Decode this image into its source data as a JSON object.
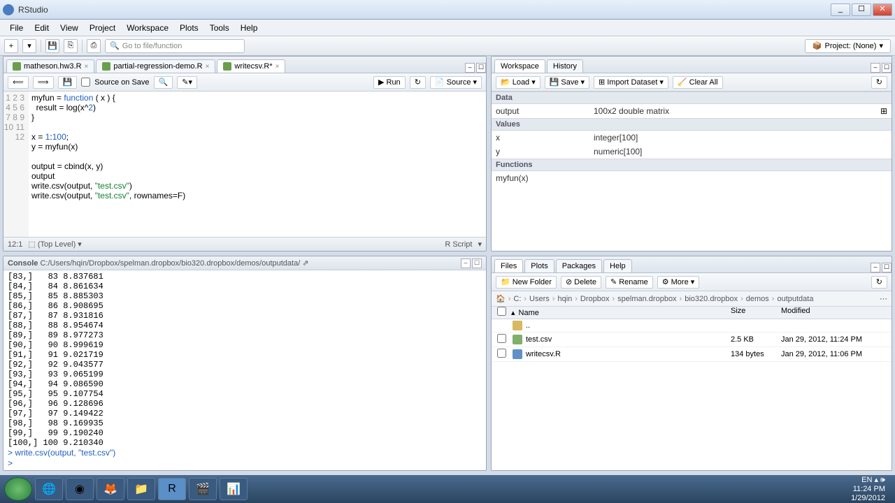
{
  "window": {
    "title": "RStudio"
  },
  "menu": {
    "file": "File",
    "edit": "Edit",
    "view": "View",
    "project": "Project",
    "workspace": "Workspace",
    "plots": "Plots",
    "tools": "Tools",
    "help": "Help"
  },
  "toolbar": {
    "goto": "Go to file/function",
    "project_btn": "Project: (None)"
  },
  "source": {
    "tabs": [
      {
        "label": "matheson.hw3.R"
      },
      {
        "label": "partial-regression-demo.R"
      },
      {
        "label": "writecsv.R*"
      }
    ],
    "source_on_save": "Source on Save",
    "run": "Run",
    "source_btn": "Source",
    "lines": [
      "myfun = function ( x ) {",
      "  result = log(x^2)",
      "}",
      "",
      "x = 1:100;",
      "y = myfun(x)",
      "",
      "output = cbind(x, y)",
      "output",
      "write.csv(output, \"test.csv\")",
      "write.csv(output, \"test.csv\", rownames=F)",
      ""
    ],
    "status_pos": "12:1",
    "status_scope": "(Top Level)",
    "status_lang": "R Script"
  },
  "console": {
    "title": "Console",
    "path": "C:/Users/hqin/Dropbox/spelman.dropbox/bio320.dropbox/demos/outputdata/",
    "rows": [
      "[83,]   83 8.837681",
      "[84,]   84 8.861634",
      "[85,]   85 8.885303",
      "[86,]   86 8.908695",
      "[87,]   87 8.931816",
      "[88,]   88 8.954674",
      "[89,]   89 8.977273",
      "[90,]   90 8.999619",
      "[91,]   91 9.021719",
      "[92,]   92 9.043577",
      "[93,]   93 9.065199",
      "[94,]   94 9.086590",
      "[95,]   95 9.107754",
      "[96,]   96 9.128696",
      "[97,]   97 9.149422",
      "[98,]   98 9.169935",
      "[99,]   99 9.190240",
      "[100,] 100 9.210340"
    ],
    "last_cmd": "write.csv(output, \"test.csv\")"
  },
  "workspace": {
    "tabs": {
      "workspace": "Workspace",
      "history": "History"
    },
    "load": "Load",
    "save": "Save",
    "import": "Import Dataset",
    "clear": "Clear All",
    "sections": {
      "data": "Data",
      "values": "Values",
      "functions": "Functions"
    },
    "data_rows": [
      {
        "n": "output",
        "v": "100x2 double matrix"
      }
    ],
    "value_rows": [
      {
        "n": "x",
        "v": "integer[100]"
      },
      {
        "n": "y",
        "v": "numeric[100]"
      }
    ],
    "func_rows": [
      {
        "n": "myfun(x)",
        "v": ""
      }
    ]
  },
  "files": {
    "tabs": {
      "files": "Files",
      "plots": "Plots",
      "packages": "Packages",
      "help": "Help"
    },
    "newfolder": "New Folder",
    "delete": "Delete",
    "rename": "Rename",
    "more": "More",
    "breadcrumb": [
      "C:",
      "Users",
      "hqin",
      "Dropbox",
      "spelman.dropbox",
      "bio320.dropbox",
      "demos",
      "outputdata"
    ],
    "cols": {
      "name": "Name",
      "size": "Size",
      "mod": "Modified"
    },
    "up": "..",
    "rows": [
      {
        "name": "test.csv",
        "size": "2.5 KB",
        "mod": "Jan 29, 2012, 11:24 PM",
        "kind": "csv"
      },
      {
        "name": "writecsv.R",
        "size": "134 bytes",
        "mod": "Jan 29, 2012, 11:06 PM",
        "kind": "r"
      }
    ]
  },
  "tray": {
    "lang": "EN",
    "time": "11:24 PM",
    "date": "1/29/2012"
  }
}
